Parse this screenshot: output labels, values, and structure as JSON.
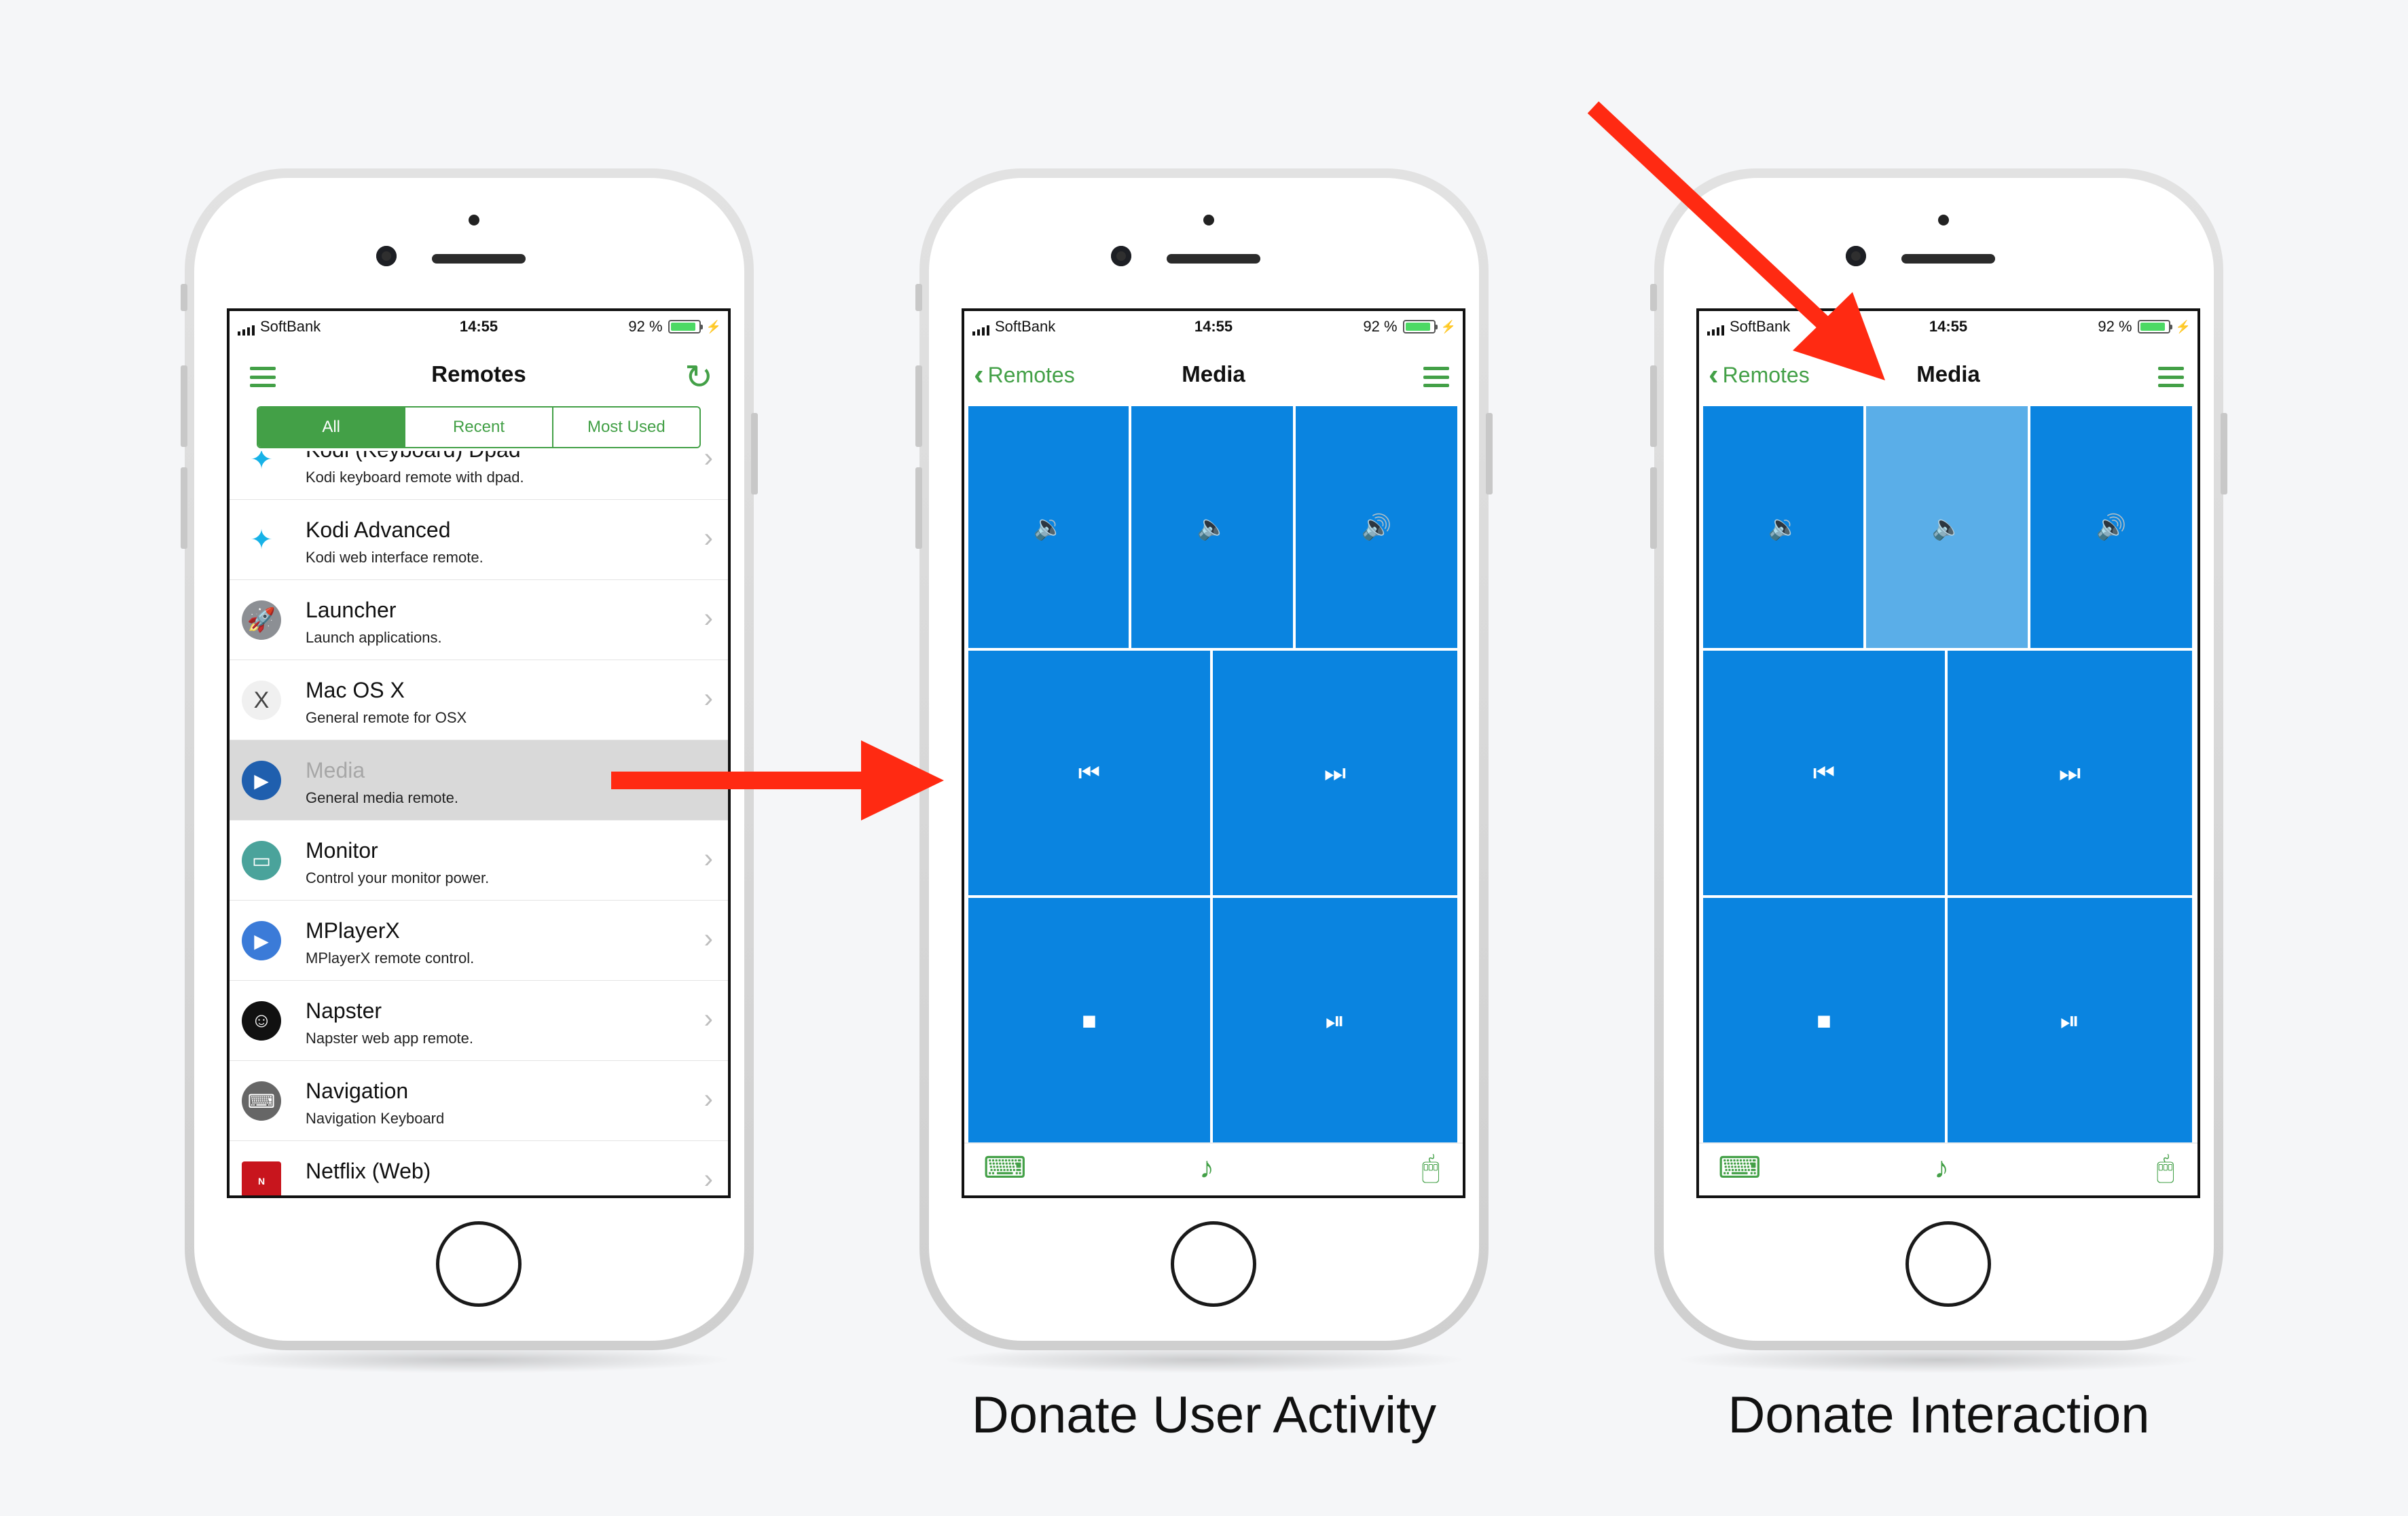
{
  "status": {
    "carrier": "SoftBank",
    "time": "14:55",
    "battery": "92 %"
  },
  "phone1": {
    "title": "Remotes",
    "tabs": [
      "All",
      "Recent",
      "Most Used"
    ],
    "active_tab": "All",
    "items": [
      {
        "name": "Kodi (Keyboard) Dpad",
        "desc": "Kodi keyboard remote with dpad."
      },
      {
        "name": "Kodi Advanced",
        "desc": "Kodi web interface remote."
      },
      {
        "name": "Launcher",
        "desc": "Launch applications."
      },
      {
        "name": "Mac OS X",
        "desc": "General remote for OSX"
      },
      {
        "name": "Media",
        "desc": "General media remote."
      },
      {
        "name": "Monitor",
        "desc": "Control your monitor power."
      },
      {
        "name": "MPlayerX",
        "desc": "MPlayerX remote control."
      },
      {
        "name": "Napster",
        "desc": "Napster web app remote."
      },
      {
        "name": "Navigation",
        "desc": "Navigation Keyboard"
      },
      {
        "name": "Netflix (Web)",
        "desc": ""
      }
    ]
  },
  "phone2": {
    "back_label": "Remotes",
    "title": "Media"
  },
  "phone3": {
    "back_label": "Remotes",
    "title": "Media"
  },
  "media_controls": [
    "volume-down",
    "mute",
    "volume-up",
    "previous",
    "next",
    "stop",
    "play-pause"
  ],
  "captions": {
    "activity": "Donate User Activity",
    "interaction": "Donate Interaction"
  },
  "colors": {
    "accent_green": "#43a047",
    "tile_blue": "#0a84e0",
    "tile_pressed": "#5aaee8",
    "arrow_red": "#ff2a12",
    "selected_row": "#d9d9d9"
  }
}
